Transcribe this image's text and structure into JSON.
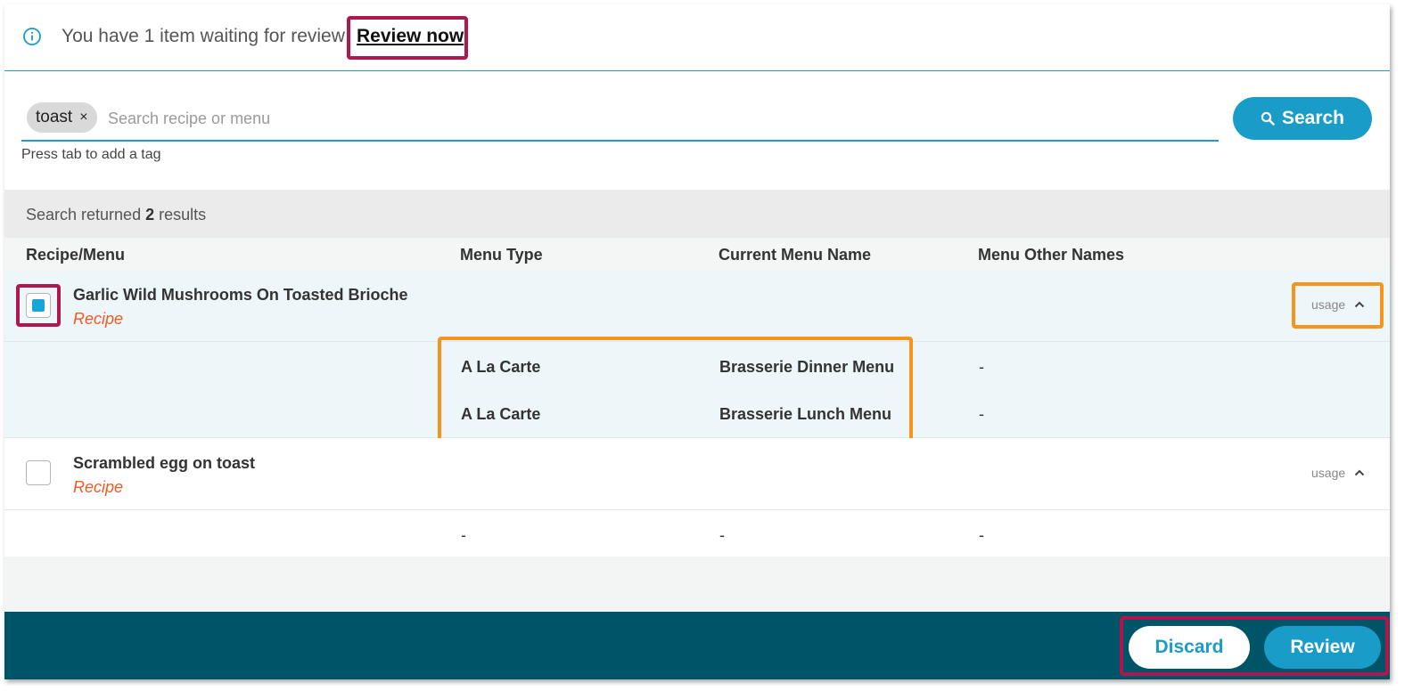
{
  "banner": {
    "message": "You have 1 item waiting for review",
    "link_label": "Review now"
  },
  "search": {
    "tags": [
      "toast"
    ],
    "tag_remove_glyph": "×",
    "placeholder": "Search recipe or menu",
    "hint": "Press tab to add a tag",
    "button_label": "Search"
  },
  "results": {
    "prefix": "Search returned",
    "count": "2",
    "suffix": "results"
  },
  "table": {
    "columns": [
      "Recipe/Menu",
      "Menu Type",
      "Current Menu Name",
      "Menu Other Names"
    ],
    "rows": [
      {
        "name": "Garlic Wild Mushrooms On Toasted Brioche",
        "type": "Recipe",
        "checked": true,
        "usage_label": "usage",
        "usage": [
          {
            "menu_type": "A La Carte",
            "current_menu_name": "Brasserie Dinner Menu",
            "other_names": "-"
          },
          {
            "menu_type": "A La Carte",
            "current_menu_name": "Brasserie Lunch Menu",
            "other_names": "-"
          }
        ]
      },
      {
        "name": "Scrambled egg on toast",
        "type": "Recipe",
        "checked": false,
        "usage_label": "usage",
        "usage": [
          {
            "menu_type": "-",
            "current_menu_name": "-",
            "other_names": "-"
          }
        ]
      }
    ]
  },
  "footer": {
    "discard_label": "Discard",
    "review_label": "Review"
  },
  "colors": {
    "accent": "#1a9cc8",
    "footer": "#005467",
    "recipe_type": "#f05a24",
    "highlight_red": "#b0174f",
    "highlight_orange": "#f7941d"
  }
}
